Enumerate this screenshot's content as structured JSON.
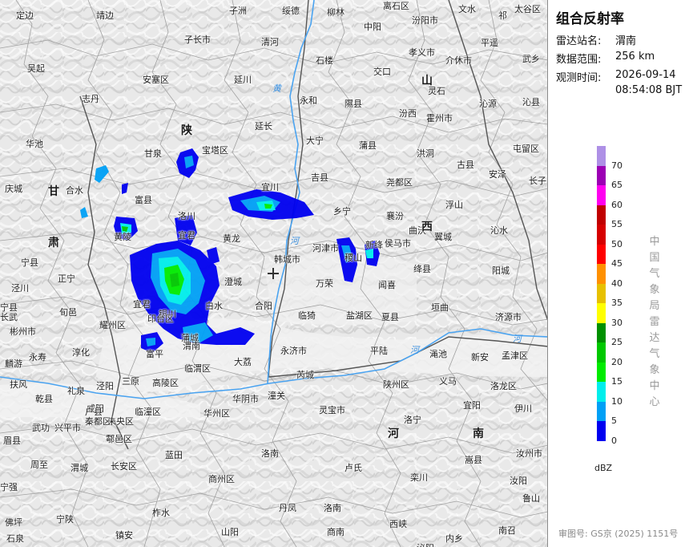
{
  "panel": {
    "title": "组合反射率",
    "station_label": "雷达站名:",
    "station_value": "渭南",
    "range_label": "数据范围:",
    "range_value": "256 km",
    "time_label": "观测时间:",
    "time_date": "2026-09-14",
    "time_clock": "08:54:08 BJT",
    "organization": "中国气象局雷达气象中心",
    "approval": "审图号: GS京 (2025) 1151号"
  },
  "legend": {
    "unit": "dBZ",
    "levels": [
      {
        "label": "",
        "color": "#ae90e6"
      },
      {
        "label": "70",
        "color": "#9c00b4"
      },
      {
        "label": "65",
        "color": "#ff00f0"
      },
      {
        "label": "60",
        "color": "#c00000"
      },
      {
        "label": "55",
        "color": "#d60000"
      },
      {
        "label": "50",
        "color": "#ff0000"
      },
      {
        "label": "45",
        "color": "#ff9000"
      },
      {
        "label": "40",
        "color": "#e7c000"
      },
      {
        "label": "35",
        "color": "#ffff00"
      },
      {
        "label": "30",
        "color": "#009000"
      },
      {
        "label": "25",
        "color": "#00c800"
      },
      {
        "label": "20",
        "color": "#00ec00"
      },
      {
        "label": "15",
        "color": "#00eeec"
      },
      {
        "label": "10",
        "color": "#00a0f6"
      },
      {
        "label": "5",
        "color": "#0000f0"
      },
      {
        "label": "0",
        "color": ""
      }
    ]
  },
  "map": {
    "provinces": [
      "陕",
      "甘",
      "肃",
      "山",
      "西",
      "河",
      "南"
    ],
    "rivers": [
      "黄",
      "河",
      "河",
      "河"
    ],
    "places": [
      "定边",
      "靖边",
      "子洲",
      "绥德",
      "柳林",
      "离石区",
      "汾阳市",
      "文水",
      "祁",
      "太谷区",
      "子长市",
      "清河",
      "中阳",
      "孝义市",
      "平遥",
      "吴起",
      "安塞区",
      "延川",
      "石楼",
      "交口",
      "介休市",
      "武乡",
      "志丹",
      "永和",
      "隰县",
      "灵石",
      "沁源",
      "沁县",
      "延长",
      "汾西",
      "霍州市",
      "华池",
      "甘泉",
      "宝塔区",
      "大宁",
      "蒲县",
      "洪洞",
      "古县",
      "安泽",
      "屯留区",
      "庆城",
      "合水",
      "富县",
      "宜川",
      "吉县",
      "尧都区",
      "长子",
      "宁县",
      "洛川",
      "乡宁",
      "浮山",
      "黄陵",
      "黄龙",
      "襄汾",
      "曲沃",
      "翼城",
      "沁水",
      "宜君",
      "韩城市",
      "河津市",
      "稷山",
      "新绛",
      "侯马市",
      "正宁",
      "宁县",
      "澄城",
      "万荣",
      "闻喜",
      "绛县",
      "阳城",
      "泾川",
      "旬邑",
      "宜君",
      "铜川",
      "合阳",
      "临猗",
      "盐湖区",
      "夏县",
      "垣曲",
      "济源市",
      "长武",
      "彬州市",
      "耀州区",
      "印台区",
      "白水",
      "蒲城",
      "永济市",
      "平陆",
      "渑池",
      "新安",
      "孟津区",
      "永寿",
      "淳化",
      "富平",
      "渭南",
      "大荔",
      "芮城",
      "陕州区",
      "义马",
      "洛龙区",
      "麟游",
      "礼泉",
      "泾阳",
      "三原",
      "高陵区",
      "临渭区",
      "华阴市",
      "潼关",
      "灵宝市",
      "宜阳",
      "伊川",
      "扶风",
      "乾县",
      "咸阳",
      "秦都区",
      "未央区",
      "临潼区",
      "华州区",
      "洛宁",
      "汝州市",
      "眉县",
      "武功",
      "兴平市",
      "户县",
      "鄠邑区",
      "长安区",
      "蓝田",
      "卢氏",
      "栾川",
      "嵩县",
      "汝阳",
      "周至",
      "渭城",
      "商州区",
      "洛南",
      "丹凤",
      "西峡",
      "内乡",
      "南召",
      "鲁山",
      "宁陕",
      "柞水",
      "镇安",
      "山阳",
      "商南",
      "佛坪",
      "石泉",
      "泌阳",
      "洛南",
      "宁强"
    ]
  }
}
